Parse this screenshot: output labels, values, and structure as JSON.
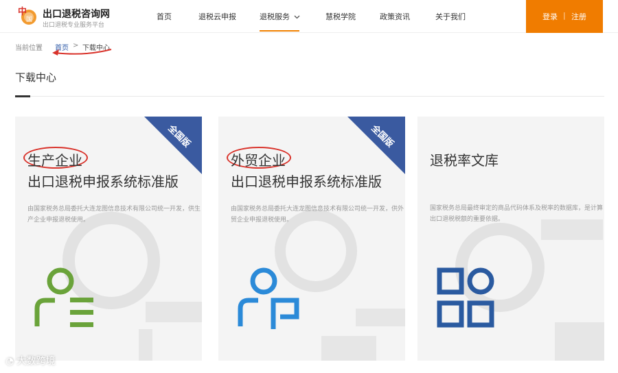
{
  "brand": {
    "logo_name": "china-tax-refund-logo",
    "title": "出口退税咨询网",
    "subtitle": "出口退税专业服务平台"
  },
  "nav": {
    "items": [
      {
        "label": "首页"
      },
      {
        "label": "退税云申报"
      },
      {
        "label": "退税服务",
        "active": true
      },
      {
        "label": "慧税学院"
      },
      {
        "label": "政策资讯"
      },
      {
        "label": "关于我们"
      }
    ],
    "login": "登录",
    "separator": "|",
    "register": "注册",
    "accent": "#f07c00"
  },
  "breadcrumb": {
    "prefix": "当前位置",
    "home": "首页",
    "sep": ">",
    "current": "下载中心"
  },
  "page_title": "下载中心",
  "cards": [
    {
      "ribbon": "全国版",
      "title_line1": "生产企业",
      "title_line2": "出口退税申报系统标准版",
      "description": "由国家税务总局委托大连龙图信息技术有限公司统一开发，供生产企业申报退税使用。",
      "icon": "user-list-icon",
      "icon_color": "#6aa33a"
    },
    {
      "ribbon": "全国版",
      "title_line1": "外贸企业",
      "title_line2": "出口退税申报系统标准版",
      "description": "由国家税务总局委托大连龙图信息技术有限公司统一开发，供外贸企业申报退税使用。",
      "icon": "user-doc-icon",
      "icon_color": "#2b8ad8"
    },
    {
      "title_line1": "退税率文库",
      "description": "国家税务总局最终审定的商品代码体系及税率的数据库，是计算出口退税税额的重要依据。",
      "icon": "grid-apps-icon",
      "icon_color": "#2a5aa0"
    }
  ],
  "ribbon_color": "#3a5aa0",
  "watermark": "大数跨境"
}
